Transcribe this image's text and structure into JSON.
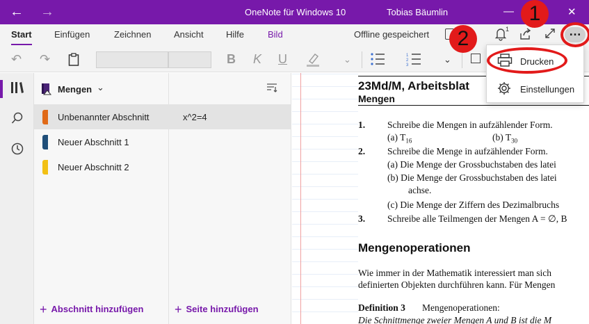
{
  "titlebar": {
    "app_title": "OneNote für Windows 10",
    "user": "Tobias Bäumlin"
  },
  "ribbon": {
    "tabs": [
      "Start",
      "Einfügen",
      "Zeichnen",
      "Ansicht",
      "Hilfe",
      "Bild"
    ],
    "active_tab": "Start",
    "offline_status": "Offline gespeichert",
    "notification_count": "1"
  },
  "notebook": {
    "name": "Mengen"
  },
  "sections": [
    {
      "label": "Unbenannter Abschnitt",
      "color": "#e06a18",
      "selected": true
    },
    {
      "label": "Neuer Abschnitt 1",
      "color": "#1f4e79",
      "selected": false
    },
    {
      "label": "Neuer Abschnitt 2",
      "color": "#f2c014",
      "selected": false
    }
  ],
  "pages": [
    {
      "label": "x^2=4"
    }
  ],
  "actions": {
    "add_section": "Abschnitt hinzufügen",
    "add_page": "Seite hinzufügen"
  },
  "dropdown": {
    "items": [
      {
        "label": "Drucken",
        "icon": "printer-icon"
      },
      {
        "label": "Einstellungen",
        "icon": "gear-icon"
      }
    ]
  },
  "annotations": {
    "badge_1": "1",
    "badge_2": "2",
    "color": "#e21a1a"
  },
  "document": {
    "title": "23Md/M, Arbeitsblat",
    "subtitle": "Mengen",
    "lines": [
      "1.",
      "Schreibe die Mengen in aufzählender Form.",
      "(a)  T",
      "16",
      "(b)  T",
      "30",
      "2.",
      "Schreibe die Menge in aufzählender Form.",
      "(a)  Die Menge der Grossbuchstaben des latei",
      "(b)  Die Menge der Grossbuchstaben des latei",
      "achse.",
      "(c)  Die Menge der Ziffern des Dezimalbruchs",
      "3.",
      "Schreibe alle Teilmengen der Mengen A = ∅, B"
    ],
    "heading2": "Mengenoperationen",
    "para": [
      "Wie immer in der Mathematik interessiert man sich",
      "definierten Objekten durchführen kann. Für Mengen"
    ],
    "definition_label": "Definition 3",
    "definition_text": "Mengenoperationen:",
    "last_line": "Die Schnittmenge zweier Mengen A und B ist die M"
  }
}
